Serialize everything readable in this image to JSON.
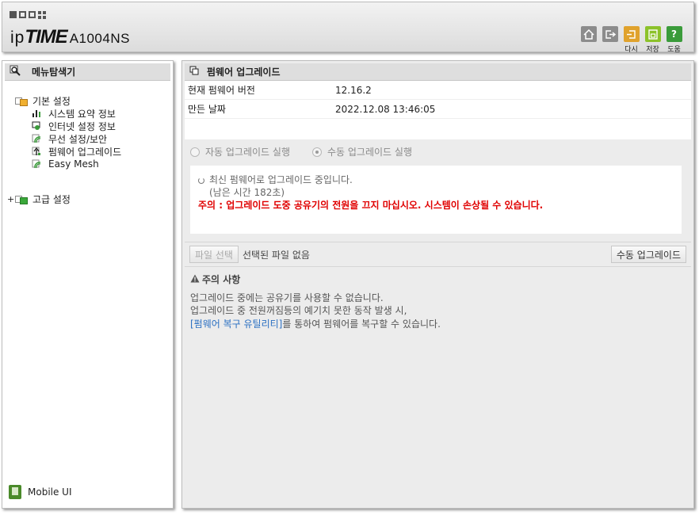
{
  "header": {
    "brand_ip": "ip",
    "brand_time": "TIME",
    "model": "A1004NS",
    "buttons": {
      "home_icon": "home-icon",
      "logout_icon": "logout-icon",
      "reload_label": "다시",
      "save_label": "저장",
      "help_label": "도움",
      "help_glyph": "?"
    }
  },
  "sidebar": {
    "title": "메뉴탐색기",
    "groups": [
      {
        "label": "기본 설정",
        "toggle": "",
        "items": [
          {
            "label": "시스템 요약 정보"
          },
          {
            "label": "인터넷 설정 정보"
          },
          {
            "label": "무선 설정/보안"
          },
          {
            "label": "펌웨어 업그레이드"
          },
          {
            "label": "Easy Mesh"
          }
        ]
      },
      {
        "label": "고급 설정",
        "toggle": "+"
      }
    ],
    "mobile_label": "Mobile UI"
  },
  "main": {
    "title": "펌웨어 업그레이드",
    "info": [
      {
        "key": "현재 펌웨어 버전",
        "value": "12.16.2"
      },
      {
        "key": "만든 날짜",
        "value": "2022.12.08 13:46:05"
      }
    ],
    "radios": {
      "auto": "자동 업그레이드 실행",
      "manual": "수동 업그레이드 실행",
      "selected": "manual"
    },
    "status": {
      "line1": "최신 펌웨어로 업그레이드 중입니다.",
      "line2": "(남은 시간 182초)",
      "warning": "주의 : 업그레이드 도중 공유기의 전원을 끄지 마십시오. 시스템이 손상될 수 있습니다."
    },
    "file": {
      "choose_label": "파일 선택",
      "no_file": "선택된 파일 없음",
      "upgrade_button": "수동 업그레이드"
    },
    "caution": {
      "title": "주의 사항",
      "line1": "업그레이드 중에는 공유기를 사용할 수 없습니다.",
      "line2": "업그레이드 중 전원꺼짐등의 예기치 못한 동작 발생 시,",
      "link_text": "[펌웨어 복구 유틸리티]",
      "line3_rest": "를 통하여 펌웨어를 복구할 수 있습니다."
    }
  },
  "colors": {
    "warning": "#e00000",
    "link": "#2a6fc2",
    "reload_button": "#e0a22c",
    "save_button": "#8cc22a",
    "help_button": "#3a9b3a"
  }
}
